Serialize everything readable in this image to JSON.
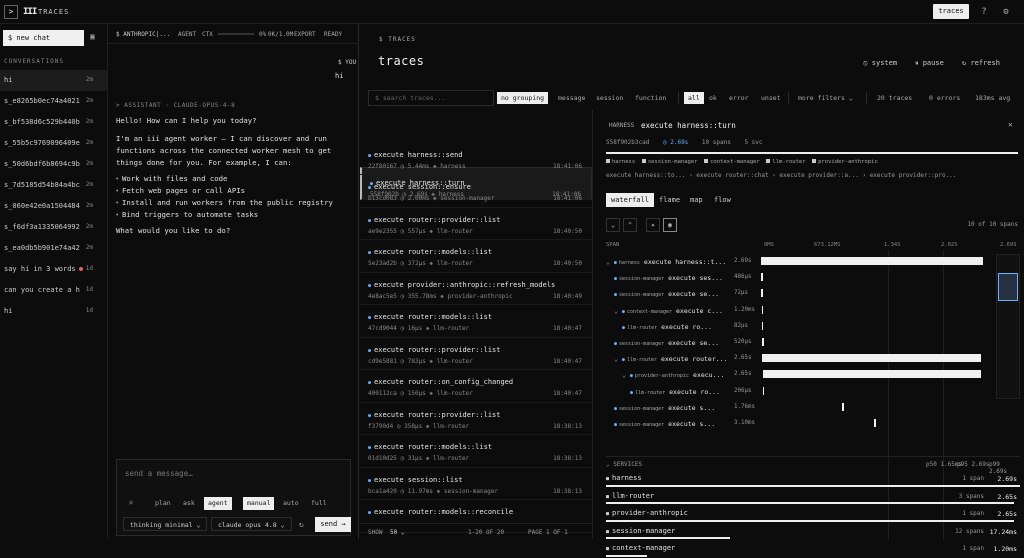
{
  "topbar": {
    "title": "TRACES",
    "traces_btn": "traces"
  },
  "sidebar": {
    "new_chat": "$ new chat",
    "conversations_label": "CONVERSATIONS",
    "items": [
      {
        "title": "hi",
        "age": "2m",
        "active": true
      },
      {
        "title": "s_e8265b0ec74a4021...",
        "age": "2m"
      },
      {
        "title": "s_bf538d6c529b440b...",
        "age": "2m"
      },
      {
        "title": "s_55b5c9769096409e...",
        "age": "2m"
      },
      {
        "title": "s_50d6bdf6b8694c9b...",
        "age": "2m"
      },
      {
        "title": "s_7d5185d54b84a4bc6...",
        "age": "2m"
      },
      {
        "title": "s_060e42e0a1504484...",
        "age": "2m"
      },
      {
        "title": "s_f6df3a1335064992...",
        "age": "2m"
      },
      {
        "title": "s_ea0db5b901e74a42...",
        "age": "2m"
      },
      {
        "title": "say hi in 3 words",
        "age": "1d",
        "dot": true
      },
      {
        "title": "can you create a h...",
        "age": "1d"
      },
      {
        "title": "hi",
        "age": "1d"
      }
    ]
  },
  "chat": {
    "header": {
      "provider": "$ ANTHROPIC|...",
      "agent": "AGENT",
      "ctx": "CTX",
      "pct": "0%",
      "tokens": "0K/1.0M",
      "export": "EXPORT",
      "ready": "READY"
    },
    "you_label": "$ YOU",
    "user_message": "hi",
    "assistant_label": "> ASSISTANT · CLAUDE-OPUS-4-8",
    "assistant_p1": "Hello! How can I help you today?",
    "assistant_p2": "I'm an iii agent worker — I can discover and run functions across the connected worker mesh to get things done for you. For example, I can:",
    "assistant_bullets": [
      "Work with files and code",
      "Fetch web pages or call APIs",
      "Install and run workers from the public registry",
      "Bind triggers to automate tasks"
    ],
    "assistant_p3": "What would you like to do?",
    "composer": {
      "placeholder": "send a message…",
      "modes": [
        "plan",
        "ask",
        "agent"
      ],
      "approvals": [
        "manual",
        "auto",
        "full"
      ],
      "thinking": "thinking minimal ⌄",
      "model": "claude opus 4.8 ⌄",
      "send": "send →"
    }
  },
  "traces": {
    "breadcrumb": "$ TRACES",
    "title": "traces",
    "actions": [
      "system",
      "pause",
      "refresh"
    ],
    "search_placeholder": "$ search traces...",
    "groupings": [
      "no grouping",
      "message",
      "session",
      "function"
    ],
    "status_filters": [
      "all",
      "ok",
      "error",
      "unset"
    ],
    "more_filters": "more filters ⌄",
    "counts": {
      "traces": "20 traces",
      "errors": "0 errors",
      "avg": "183ms avg"
    },
    "list": [
      {
        "name": "execute harness::turn",
        "id": "558f902b",
        "dur": "2.69s",
        "svc": "harness",
        "time": "18:41:06"
      },
      {
        "name": "execute harness::send",
        "id": "22f80167",
        "dur": "5.44ms",
        "svc": "harness",
        "time": "18:41:06"
      },
      {
        "name": "execute session::ensure",
        "id": "b13cd083",
        "dur": "2.00ms",
        "svc": "session-manager",
        "time": "18:41:06"
      },
      {
        "name": "execute router::provider::list",
        "id": "ae9e2355",
        "dur": "557µs",
        "svc": "llm-router",
        "time": "18:40:50"
      },
      {
        "name": "execute router::models::list",
        "id": "5e23ad2b",
        "dur": "372µs",
        "svc": "llm-router",
        "time": "18:40:50"
      },
      {
        "name": "execute provider::anthropic::refresh_models",
        "id": "4e8ac5e5",
        "dur": "355.78ms",
        "svc": "provider-anthropic",
        "time": "18:40:49"
      },
      {
        "name": "execute router::models::list",
        "id": "47cd9044",
        "dur": "16µs",
        "svc": "llm-router",
        "time": "18:40:47"
      },
      {
        "name": "execute router::provider::list",
        "id": "cd9e5881",
        "dur": "783µs",
        "svc": "llm-router",
        "time": "18:40:47"
      },
      {
        "name": "execute router::on_config_changed",
        "id": "400112ca",
        "dur": "150µs",
        "svc": "llm-router",
        "time": "18:40:47"
      },
      {
        "name": "execute router::provider::list",
        "id": "f3790d4",
        "dur": "358µs",
        "svc": "llm-router",
        "time": "18:38:13"
      },
      {
        "name": "execute router::models::list",
        "id": "01d10d25",
        "dur": "31µs",
        "svc": "llm-router",
        "time": "18:38:13"
      },
      {
        "name": "execute session::list",
        "id": "bca1a420",
        "dur": "11.97ms",
        "svc": "session-manager",
        "time": "18:38:13"
      },
      {
        "name": "execute router::models::reconcile",
        "id": "",
        "dur": "",
        "svc": "",
        "time": ""
      }
    ],
    "footer": {
      "show": "SHOW",
      "per_page": "50 ⌄",
      "range": "1-20 OF 20",
      "page": "PAGE 1 OF 1"
    }
  },
  "detail": {
    "label": "HARNESS",
    "title": "execute harness::turn",
    "id": "558f902b3cad",
    "duration": "2.69s",
    "spans": "10 spans",
    "services": "5 svc",
    "progress": 1.0,
    "legend": [
      "harness",
      "session-manager",
      "context-manager",
      "llm-router",
      "provider-anthropic"
    ],
    "crumbs": "execute harness::to... › execute router::chat › execute provider::a... › execute provider::pro...",
    "tabs": [
      "waterfall",
      "flame",
      "map",
      "flow"
    ],
    "span_count": "10 of 10 spans",
    "wf_head": {
      "span": "SPAN",
      "t0": "0MS",
      "t1": "673.12MS",
      "t2": "1.34S",
      "t3": "2.02S",
      "t4": "2.69S"
    },
    "spans_rows": [
      {
        "depth": 0,
        "chev": "⌄",
        "svc": "harness",
        "name": "execute harness::t...",
        "dur": "2.69s",
        "start": 0.0,
        "width": 1.0
      },
      {
        "depth": 1,
        "chev": "",
        "svc": "session-manager",
        "name": "execute ses...",
        "dur": "486µs",
        "start": 0.0,
        "width": 0.004
      },
      {
        "depth": 1,
        "chev": "",
        "svc": "session-manager",
        "name": "execute se...",
        "dur": "72µs",
        "start": 0.002,
        "width": 0.004
      },
      {
        "depth": 1,
        "chev": "⌄",
        "svc": "context-manager",
        "name": "execute c...",
        "dur": "1.20ms",
        "start": 0.003,
        "width": 0.005
      },
      {
        "depth": 2,
        "chev": "",
        "svc": "llm-router",
        "name": "execute ro...",
        "dur": "82µs",
        "start": 0.004,
        "width": 0.004
      },
      {
        "depth": 1,
        "chev": "",
        "svc": "session-manager",
        "name": "execute se...",
        "dur": "520µs",
        "start": 0.005,
        "width": 0.004
      },
      {
        "depth": 1,
        "chev": "⌄",
        "svc": "llm-router",
        "name": "execute router...",
        "dur": "2.65s",
        "start": 0.006,
        "width": 0.985
      },
      {
        "depth": 2,
        "chev": "⌄",
        "svc": "provider-anthropic",
        "name": "execu...",
        "dur": "2.65s",
        "start": 0.008,
        "width": 0.982
      },
      {
        "depth": 3,
        "chev": "",
        "svc": "llm-router",
        "name": "execute ro...",
        "dur": "206µs",
        "start": 0.008,
        "width": 0.004
      },
      {
        "depth": 1,
        "chev": "",
        "svc": "session-manager",
        "name": "execute s...",
        "dur": "1.76ms",
        "start": 0.365,
        "width": 0.004
      },
      {
        "depth": 1,
        "chev": "",
        "svc": "session-manager",
        "name": "execute s...",
        "dur": "3.10ms",
        "start": 0.51,
        "width": 0.004
      }
    ],
    "services_head": {
      "label": "⌄ SERVICES",
      "p50": "p50 1.65ms",
      "p95": "p95 2.69s",
      "p99": "p99 2.69s"
    },
    "services_rows": [
      {
        "name": "harness",
        "spans": "1 span",
        "ms": "2.69s",
        "frac": 1.0
      },
      {
        "name": "llm-router",
        "spans": "3 spans",
        "ms": "2.65s",
        "frac": 0.985
      },
      {
        "name": "provider-anthropic",
        "spans": "1 span",
        "ms": "2.65s",
        "frac": 0.985
      },
      {
        "name": "session-manager",
        "spans": "12 spans",
        "ms": "17.24ms",
        "frac": 0.3
      },
      {
        "name": "context-manager",
        "spans": "1 span",
        "ms": "1.20ms",
        "frac": 0.1
      }
    ]
  }
}
